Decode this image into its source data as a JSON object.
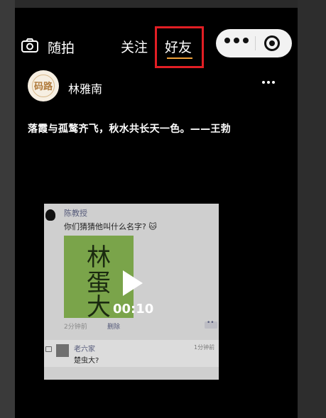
{
  "topbar": {
    "snap_label": "随拍",
    "follow_tab": "关注",
    "friends_tab": "好友",
    "camera_icon": "camera-icon",
    "more_icon": "more-dots-icon",
    "close_icon": "target-close-icon",
    "accent_color": "#f0a23a",
    "highlight_color": "#e21e24"
  },
  "post": {
    "author": "林雅南",
    "avatar_logo": "码路",
    "text": "落霞与孤鹜齐飞，秋水共长天一色。——王勃"
  },
  "video": {
    "poster_name": "陈教授",
    "question": "你们猜猜他叫什么名字? 🐱",
    "handwriting": "林蛋大",
    "duration": "00:10",
    "time_ago": "2分钟前",
    "delete_label": "删除",
    "comment": {
      "name": "老六家",
      "time": "1分钟前",
      "text": "楚虫大?"
    }
  }
}
